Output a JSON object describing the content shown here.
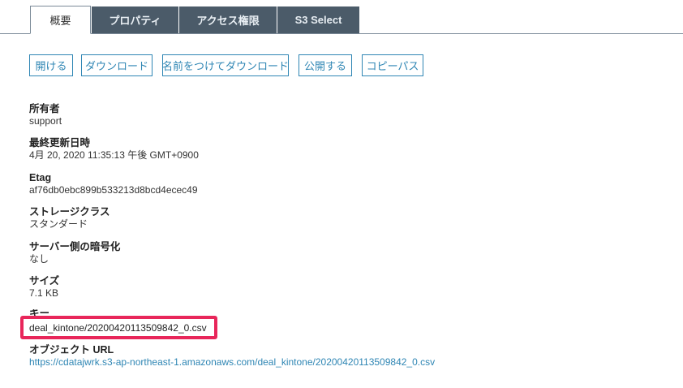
{
  "tabs": [
    {
      "label": "概要",
      "active": true
    },
    {
      "label": "プロパティ",
      "active": false
    },
    {
      "label": "アクセス権限",
      "active": false
    },
    {
      "label": "S3 Select",
      "active": false
    }
  ],
  "actions": {
    "open": "開ける",
    "download": "ダウンロード",
    "download_as": "名前をつけてダウンロード",
    "make_public": "公開する",
    "copy_path": "コピーパス"
  },
  "properties": {
    "owner": {
      "label": "所有者",
      "value": "support"
    },
    "last_modified": {
      "label": "最終更新日時",
      "value": "4月 20, 2020 11:35:13 午後 GMT+0900"
    },
    "etag": {
      "label": "Etag",
      "value": "af76db0ebc899b533213d8bcd4ecec49"
    },
    "storage_class": {
      "label": "ストレージクラス",
      "value": "スタンダード"
    },
    "encryption": {
      "label": "サーバー側の暗号化",
      "value": "なし"
    },
    "size": {
      "label": "サイズ",
      "value": "7.1 KB"
    },
    "key": {
      "label": "キー",
      "value": "deal_kintone/20200420113509842_0.csv"
    },
    "object_url": {
      "label": "オブジェクト URL",
      "value": "https://cdatajwrk.s3-ap-northeast-1.amazonaws.com/deal_kintone/20200420113509842_0.csv"
    }
  },
  "colors": {
    "accent": "#2f86b4",
    "tab_inactive": "#4b5b69",
    "highlight": "#e8265a"
  }
}
